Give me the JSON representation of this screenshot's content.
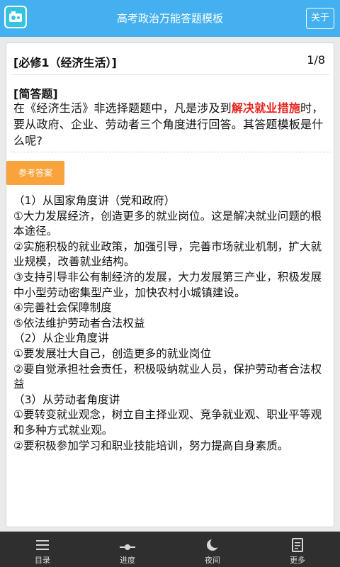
{
  "header": {
    "title": "高考政治万能答题模板",
    "about_label": "关于"
  },
  "card": {
    "chapter": "[必修1（经济生活）]",
    "page_counter": "1/8",
    "question_type": "[简答题]",
    "question_part1": "在《经济生活》非选择题题中，凡是涉及到",
    "question_highlight": "解决就业措施",
    "question_part2": "时，要从政府、企业、劳动者三个角度进行回答。其答题模板是什么呢?",
    "reference_button": "参考答案",
    "answer_lines": [
      "（1）从国家角度讲（党和政府）",
      "①大力发展经济，创造更多的就业岗位。这是解决就业问题的根本途径。",
      "②实施积极的就业政策，加强引导，完善市场就业机制，扩大就业规模，改善就业结构。",
      "③支持引导非公有制经济的发展，大力发展第三产业，积极发展中小型劳动密集型产业，加快农村小城镇建设。",
      "④完善社会保障制度",
      "⑤依法维护劳动者合法权益",
      "（2）从企业角度讲",
      "①要发展壮大自己，创造更多的就业岗位",
      "②要自觉承担社会责任，积极吸纳就业人员，保护劳动者合法权益",
      "（3）从劳动者角度讲",
      "①要转变就业观念，树立自主择业观、竞争就业观、职业平等观和多种方式就业观。",
      "②要积极参加学习和职业技能培训，努力提高自身素质。"
    ]
  },
  "tabbar": {
    "items": [
      {
        "label": "目录",
        "icon": "list-icon"
      },
      {
        "label": "进度",
        "icon": "progress-icon"
      },
      {
        "label": "夜间",
        "icon": "moon-icon"
      },
      {
        "label": "更多",
        "icon": "more-icon"
      }
    ]
  }
}
